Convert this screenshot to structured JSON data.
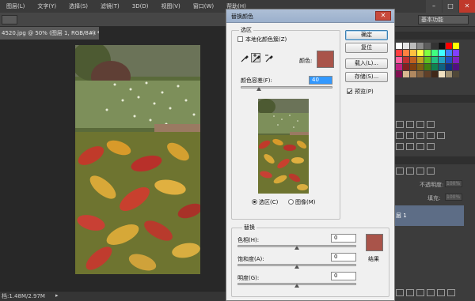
{
  "menubar": {
    "items": [
      "图层(L)",
      "文字(Y)",
      "选择(S)",
      "滤镜(T)",
      "3D(D)",
      "视图(V)",
      "窗口(W)",
      "帮助(H)"
    ],
    "window_controls": [
      "–",
      "□",
      "✕"
    ]
  },
  "options_bar": {
    "workspace": "基本功能"
  },
  "document": {
    "tab_label": "4520.jpg @ 50% (图层 1, RGB/8#) *",
    "tab_close": "×",
    "status": "档:1.48M/2.97M",
    "status_arrow": "▸"
  },
  "layers_panel": {
    "opacity_label": "不透明度:",
    "opacity_value": "100%",
    "fill_label": "填充:",
    "fill_value": "100%",
    "layer_name": "层 1"
  },
  "dialog": {
    "title": "替换颜色",
    "close": "✕",
    "selection_group": "选区",
    "localized_clusters_label": "本地化颜色簇(Z)",
    "localized_clusters_checked": false,
    "color_label": "颜色:",
    "selection_color": "#a9544a",
    "fuzziness_label": "颜色容差(F):",
    "fuzziness_value": "40",
    "fuzziness_fraction": 0.2,
    "view_selection_label": "选区(C)",
    "view_image_label": "图像(M)",
    "view_mode": "selection",
    "replacement_group": "替换",
    "hue_label": "色相(H):",
    "hue_value": "0",
    "saturation_label": "饱和度(A):",
    "saturation_value": "0",
    "lightness_label": "明度(G):",
    "lightness_value": "0",
    "result_label": "结果",
    "result_color": "#a9544a",
    "buttons": {
      "ok": "确定",
      "reset": "复位",
      "load": "载入(L)...",
      "save": "存储(S)..."
    },
    "preview_label": "预览(P)",
    "preview_checked": true
  }
}
